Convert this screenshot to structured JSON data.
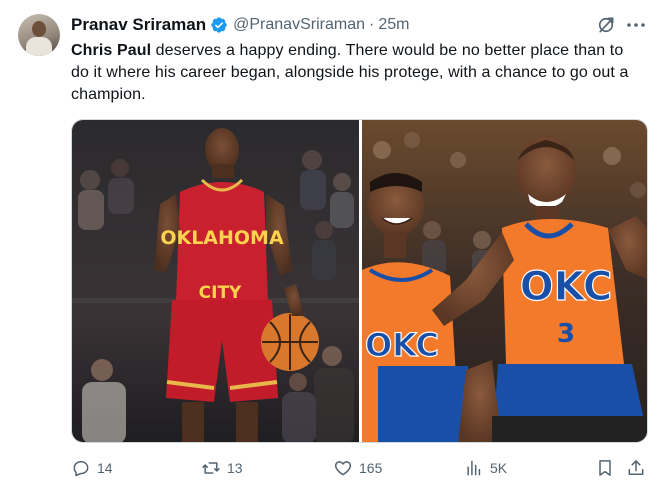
{
  "author": {
    "name": "Pranav Sriraman",
    "handle": "@PranavSriraman",
    "separator": "·",
    "time": "25m"
  },
  "tweet": {
    "mention": "Chris Paul",
    "text": " deserves a happy ending. There would be no better place than to do it where his career began, alongside his protege, with a chance to go out a champion."
  },
  "media": {
    "left_jersey_text": "OKLAHOMA",
    "left_jersey_sub": "CITY",
    "right_jersey_text": "OKC",
    "right_jersey_number": "3",
    "small_jersey_text": "OKC"
  },
  "actions": {
    "replies": "14",
    "reposts": "13",
    "likes": "165",
    "views": "5K"
  },
  "icons": [
    "avatar",
    "verified-badge-icon",
    "grok-icon",
    "more-icon",
    "reply-icon",
    "repost-icon",
    "like-icon",
    "views-icon",
    "bookmark-icon",
    "share-icon"
  ],
  "colors": {
    "verified": "#1d9bf0",
    "secondary_text": "#536471",
    "okc_orange": "#f47a2b",
    "okc_blue": "#1a4fa8",
    "hornets_red": "#c8202f"
  }
}
